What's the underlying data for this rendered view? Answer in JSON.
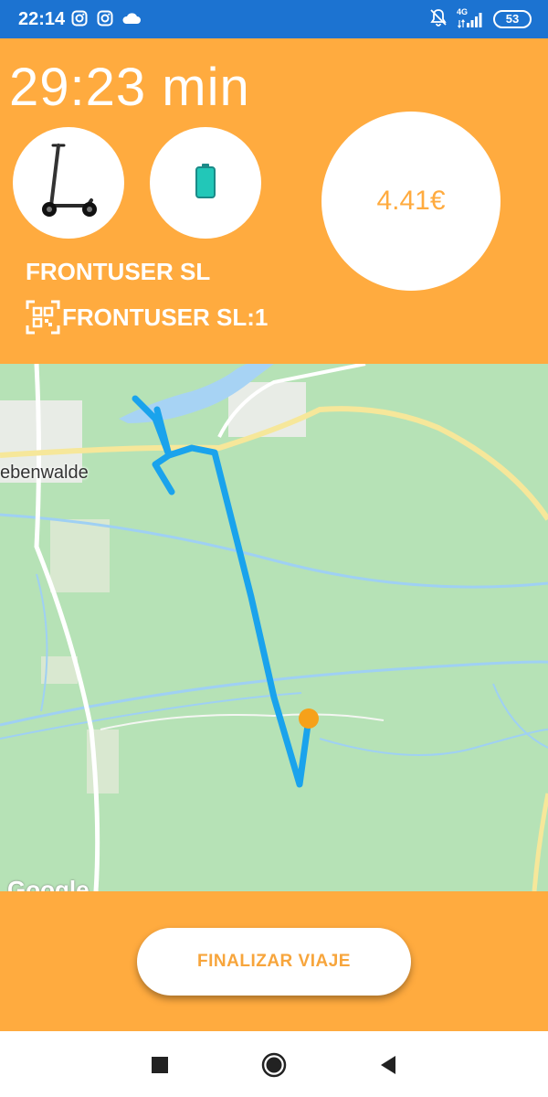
{
  "status_bar": {
    "time": "22:14",
    "network": "4G",
    "battery": "53",
    "icons": [
      "instagram-icon",
      "instagram-icon",
      "cloud-icon",
      "muted-bell-icon",
      "signal-icon",
      "battery-icon"
    ]
  },
  "trip": {
    "duration": "29:23 min",
    "price": "4.41€",
    "company": "FRONTUSER SL",
    "vehicle_id": "FRONTUSER SL:1",
    "icons": [
      "scooter-icon",
      "battery-icon",
      "qr-code-icon"
    ]
  },
  "map": {
    "place_label": "ebenwalde",
    "attribution": "Google",
    "route_color": "#1aa3ec",
    "marker_color": "#f6a11a"
  },
  "actions": {
    "finish_label": "FINALIZAR VIAJE"
  },
  "nav": {
    "icons": [
      "recents-square-icon",
      "home-circle-icon",
      "back-triangle-icon"
    ]
  },
  "colors": {
    "accent": "#ffab3f",
    "status_bar": "#1c73d1",
    "map_green": "#b6e2b6"
  }
}
